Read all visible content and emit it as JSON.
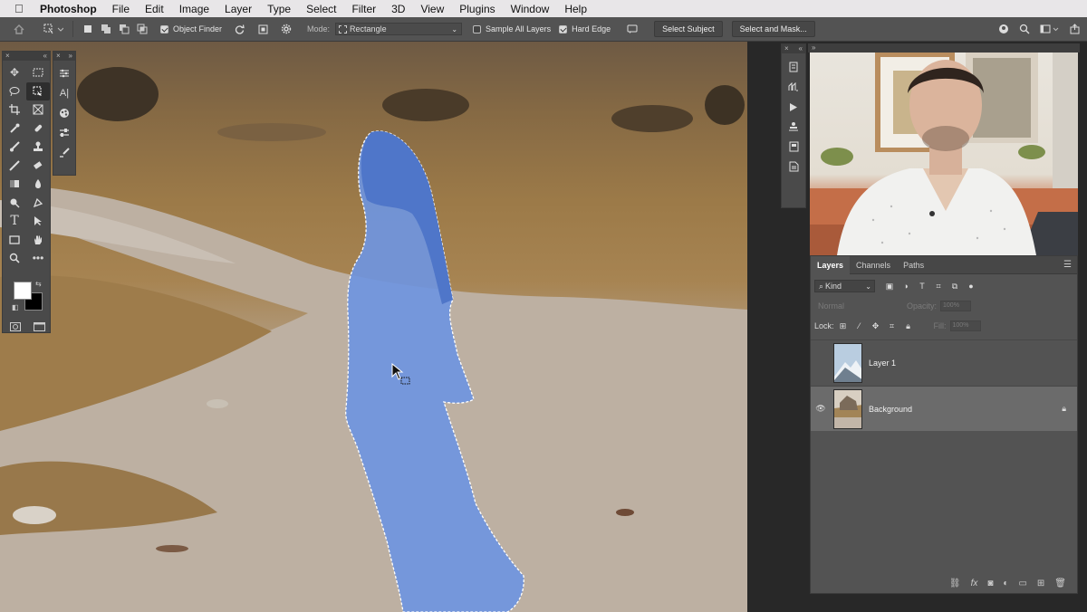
{
  "menubar": {
    "app": "Photoshop",
    "items": [
      "File",
      "Edit",
      "Image",
      "Layer",
      "Type",
      "Select",
      "Filter",
      "3D",
      "View",
      "Plugins",
      "Window",
      "Help"
    ]
  },
  "options": {
    "object_finder": "Object Finder",
    "mode_label": "Mode:",
    "mode_value": "Rectangle",
    "sample_all_layers": "Sample All Layers",
    "hard_edge": "Hard Edge",
    "select_subject": "Select Subject",
    "select_and_mask": "Select and Mask..."
  },
  "layers_panel": {
    "tabs": [
      "Layers",
      "Channels",
      "Paths"
    ],
    "kind_label": "Kind",
    "blend_mode": "Normal",
    "opacity_label": "Opacity:",
    "opacity_value": "100%",
    "lock_label": "Lock:",
    "fill_label": "Fill:",
    "fill_value": "100%",
    "layers": [
      {
        "name": "Layer 1",
        "visible": false,
        "selected": false,
        "locked": false
      },
      {
        "name": "Background",
        "visible": true,
        "selected": true,
        "locked": true
      }
    ]
  },
  "icons": {
    "selection_tint": "#6f95e0",
    "panel_bg": "#535353"
  }
}
